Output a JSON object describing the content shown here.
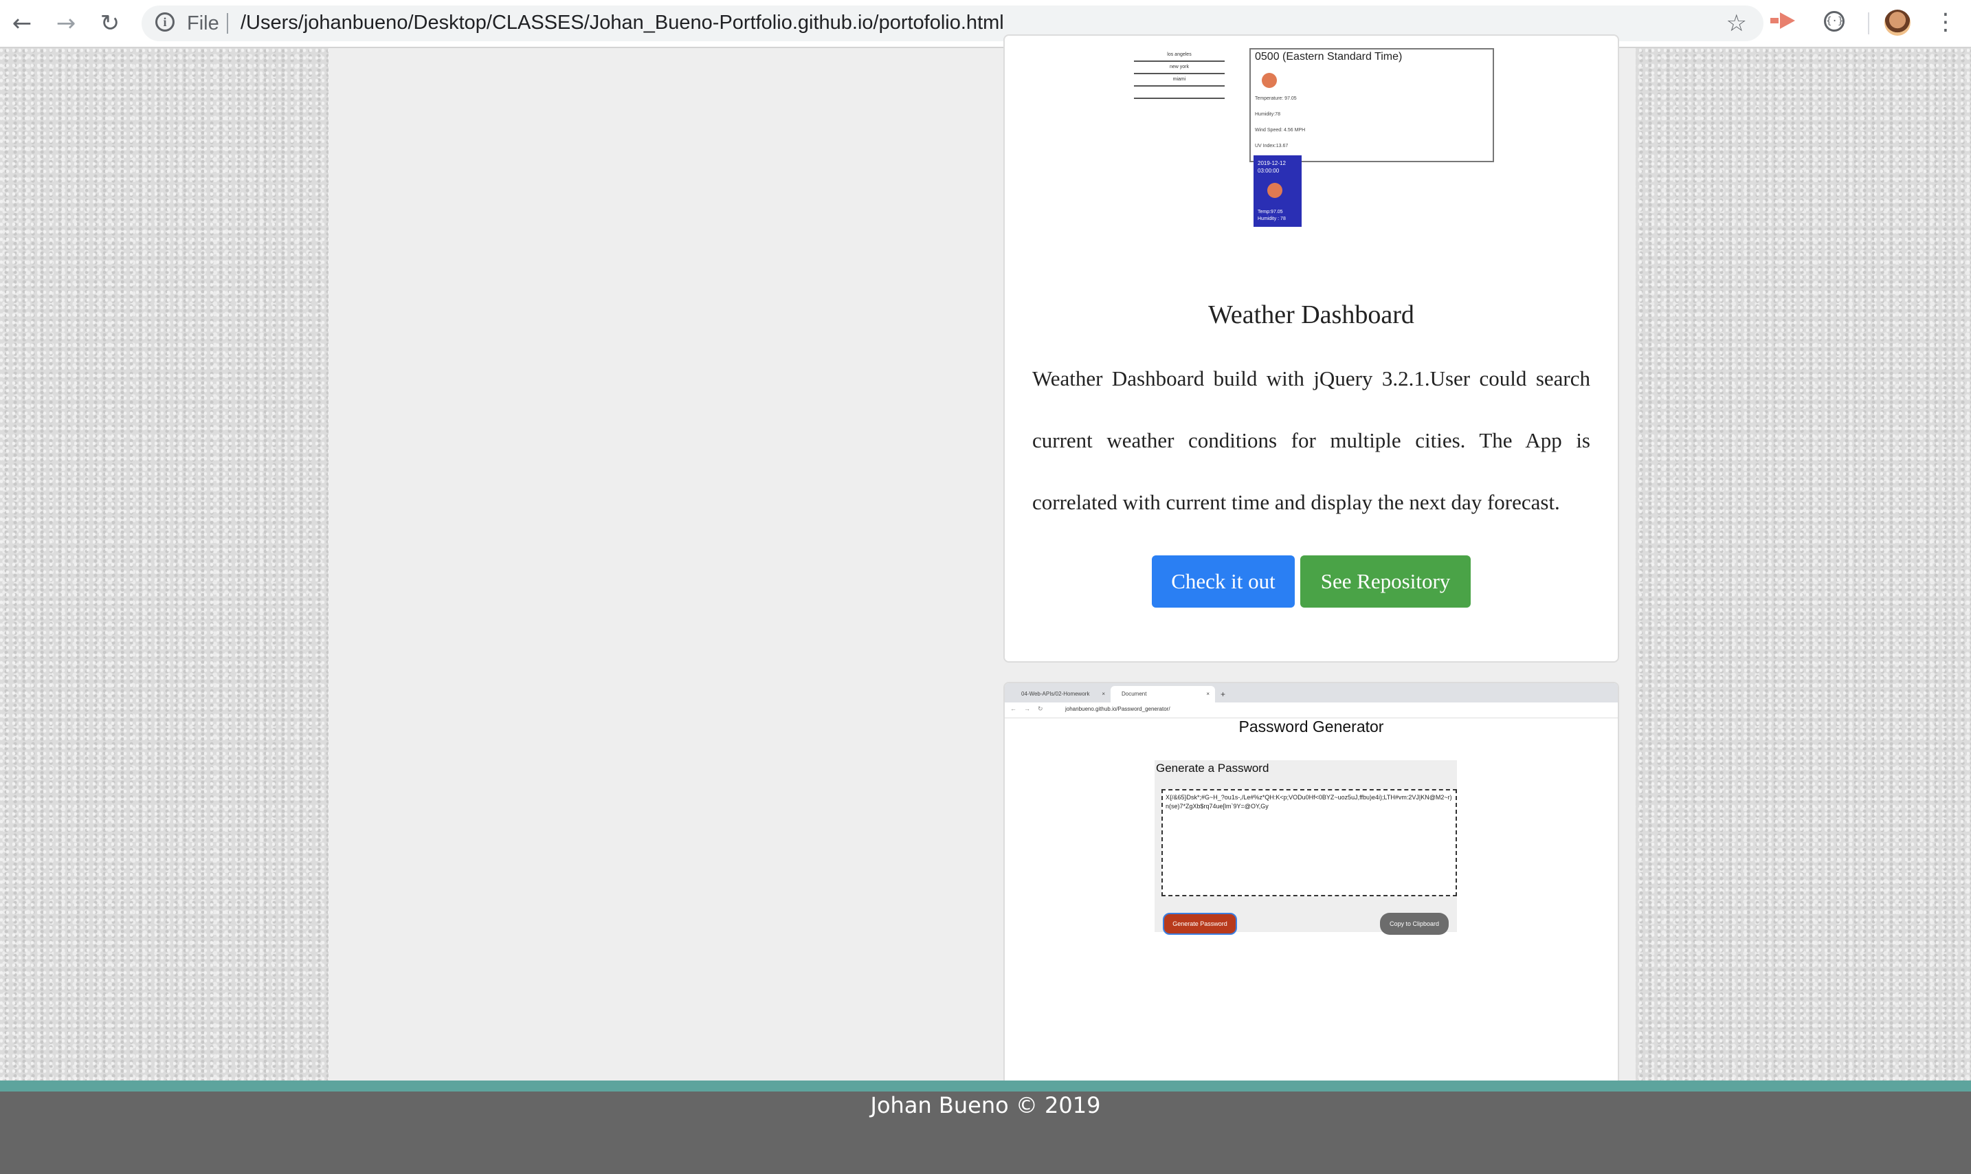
{
  "browser": {
    "file_label": "File",
    "url": "/Users/johanbueno/Desktop/CLASSES/Johan_Bueno-Portfolio.github.io/portofolio.html"
  },
  "weather_preview": {
    "cities": [
      "los angeles",
      "new york",
      "miami"
    ],
    "timezone_text": "0500 (Eastern Standard Time)",
    "lines": [
      "Temperature: 97.05",
      "Humidity:78",
      "Wind Speed: 4.56 MPH",
      "UV Index:13.67"
    ],
    "forecast": {
      "date": "2019-12-12",
      "time": "03:00:00",
      "temp": "Temp:97.05",
      "humidity": "Humidity : 78"
    }
  },
  "project_weather": {
    "title": "Weather Dashboard",
    "description": "Weather Dashboard build with jQuery 3.2.1.User could search current weather conditions for multiple cities. The App is correlated with current time and display the next day forecast.",
    "check_label": "Check it out",
    "repo_label": "See Repository"
  },
  "password_preview": {
    "tab1": "04-Web-APIs/02-Homework",
    "tab2": "Document",
    "url": "johanbueno.github.io/Password_generator/",
    "heading": "Password Generator",
    "panel_label": "Generate a Password",
    "password_text": "X{/&65}Dsk*;#G~H_?ou1s-,/Le#%z*QH:K<p;VODu0Hf<0BYZ~uoz5uJ,ffbu)e4i);LTH#vm:2VJ|KN@M2~r)n(se)7*ZgXb$rq74ue[lm`9Y=@OY,Gy",
    "generate_label": "Generate Password",
    "copy_label": "Copy to Clipboard"
  },
  "footer": {
    "text": "Johan Bueno © 2019"
  },
  "colors": {
    "check_button": "#2a7ff3",
    "repo_button": "#4aa347",
    "footer_stripe": "#5da49d",
    "footer_bg": "#666666"
  }
}
